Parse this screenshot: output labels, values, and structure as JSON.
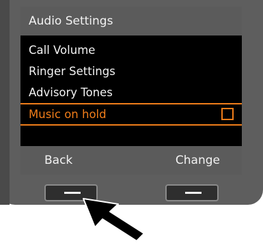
{
  "screen": {
    "title": "Audio Settings",
    "items": [
      {
        "label": "Call Volume"
      },
      {
        "label": "Ringer Settings"
      },
      {
        "label": "Advisory Tones"
      },
      {
        "label": "Music on hold",
        "selected": true,
        "checked": false
      }
    ],
    "softkeys": {
      "left": "Back",
      "right": "Change"
    }
  },
  "colors": {
    "accent": "#f07d1a",
    "bar": "#5b5b5b",
    "device": "#5e5e5e"
  }
}
